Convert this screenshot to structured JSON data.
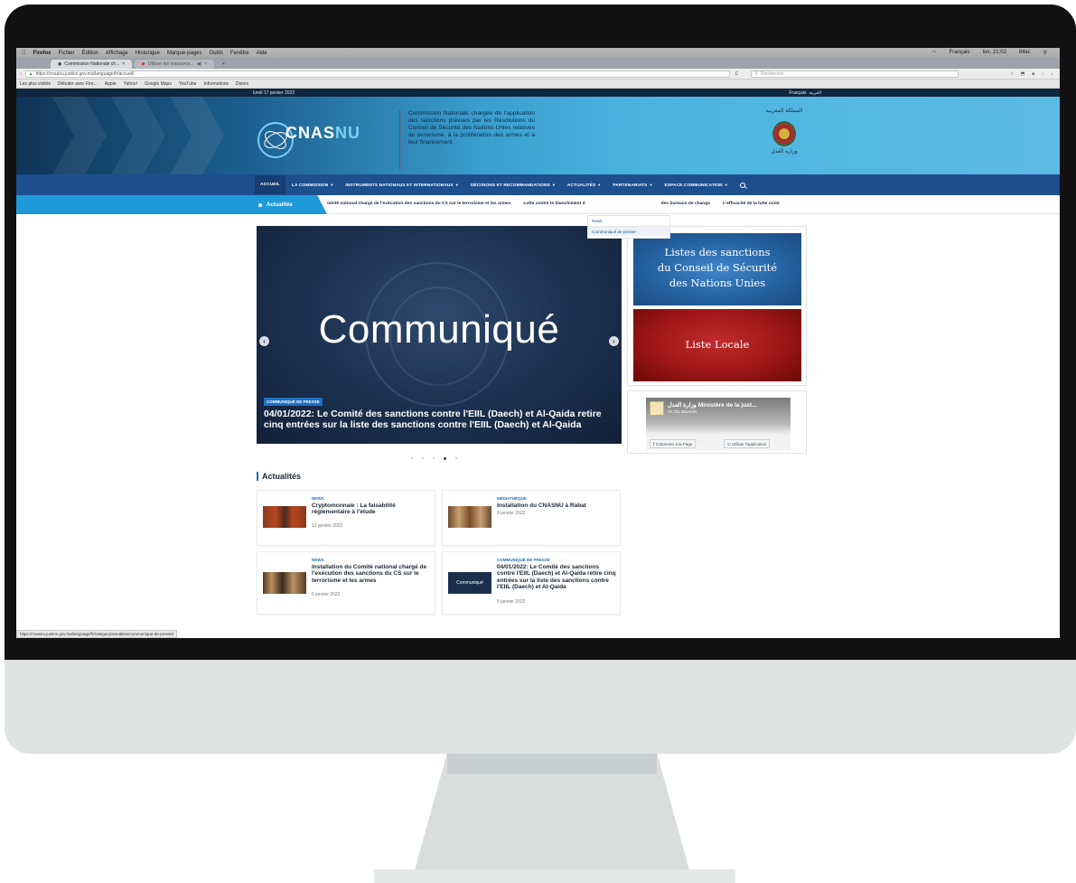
{
  "menubar": {
    "app": "Firefox",
    "items": [
      "Fichier",
      "Édition",
      "Affichage",
      "Historique",
      "Marque-pages",
      "Outils",
      "Fenêtre",
      "Aide"
    ],
    "right": {
      "lang": "Français",
      "clock": "lun. 21:02",
      "user": "iMac"
    }
  },
  "tabs": {
    "active": "Commission Nationale ch...",
    "inactive": "Utiliser les ressource...",
    "new": "+"
  },
  "urlbar": {
    "url": "https://cnasnu.justice.gov.ma/language/fr/accueil/",
    "search_placeholder": "Rechercher"
  },
  "bookmarks": [
    "Les plus visités",
    "Débuter avec Fire...",
    "Apple",
    "Yahoo!",
    "Google Maps",
    "YouTube",
    "Informations",
    "Divers"
  ],
  "site": {
    "date": "lundi 17 janvier 2022",
    "lang_fr": "Français",
    "lang_ar": "العربية",
    "logo": {
      "a": "CNAS",
      "b": "NU"
    },
    "tagline": "Commission Nationale chargée de l'application des sanctions prévues par les Résolutions du Conseil de Sécurité des Nations-Unies relatives au terrorisme, à la prolifération des armes et à leur financement",
    "emblem_top": "المملكة المغربية",
    "emblem_bottom": "وزارة العدل"
  },
  "nav": [
    {
      "label": "ACCUEIL",
      "caret": false
    },
    {
      "label": "LA COMMISSION",
      "caret": true
    },
    {
      "label": "INSTRUMENTS NATIONAUX ET INTERNATIONAUX",
      "caret": true
    },
    {
      "label": "DÉCISIONS ET RECOMMANDATIONS",
      "caret": true
    },
    {
      "label": "ACTUALITÉS",
      "caret": true
    },
    {
      "label": "PARTENARIATS",
      "caret": true
    },
    {
      "label": "ESPACE COMMUNICATION",
      "caret": true
    }
  ],
  "dropdown": [
    "News",
    "Communiqué de presse"
  ],
  "ticker": {
    "label": "Actualités",
    "items": [
      "omité national chargé de l'exécution des sanctions du CS sur le terrorisme et les armes",
      "Lutte contre le blanchiment d",
      "des bureaux de change",
      "L'efficacité de la lutte contr"
    ]
  },
  "slider": {
    "headline": "Communiqué",
    "badge": "COMMUNIQUÉ DE PRESSE",
    "caption": "04/01/2022: Le Comité des sanctions contre l'EIIL (Daech) et Al-Qaida retire cinq entrées sur la liste des sanctions contre l'EIIL (Daech) et Al-Qaida",
    "prev": "‹",
    "next": "›",
    "dots": 5,
    "active_dot": 4
  },
  "side": {
    "un_list": [
      "Listes des sanctions",
      "du Conseil de Sécurité",
      "des Nations Unies"
    ],
    "local_list": "Liste Locale"
  },
  "facebook": {
    "title": "وزارة العدل Ministère de la just...",
    "subscribers": "70 731 abonnés",
    "follow": "S'abonner à la Page",
    "app": "Utiliser l'application"
  },
  "news": {
    "section_title": "Actualités",
    "items": [
      {
        "cat": "NEWS",
        "title": "Cryptomonnaie : La faisabilité réglementaire à l'étude",
        "date": "13 janvier 2022"
      },
      {
        "cat": "MÉDIATHÈQUE",
        "title": "Installation du CNASNU à Rabat",
        "date": "9 janvier 2022"
      },
      {
        "cat": "NEWS",
        "title": "Installation du Comité national chargé de l'exécution des sanctions du CS sur le terrorisme et les armes",
        "date": "6 janvier 2022"
      },
      {
        "cat": "COMMUNIQUÉ DE PRESSE",
        "title": "04/01/2022: Le Comité des sanctions contre l'EIIL (Daech) et Al-Qaida retire cinq entrées sur la liste des sanctions contre l'EIIL (Daech) et Al-Qaida",
        "date": "5 janvier 2022",
        "thumb_text": "Communiqué"
      }
    ]
  },
  "status_url": "https://cnasnu.justice.gov.ma/language/fr/category/actualites/communique-de-presse/"
}
